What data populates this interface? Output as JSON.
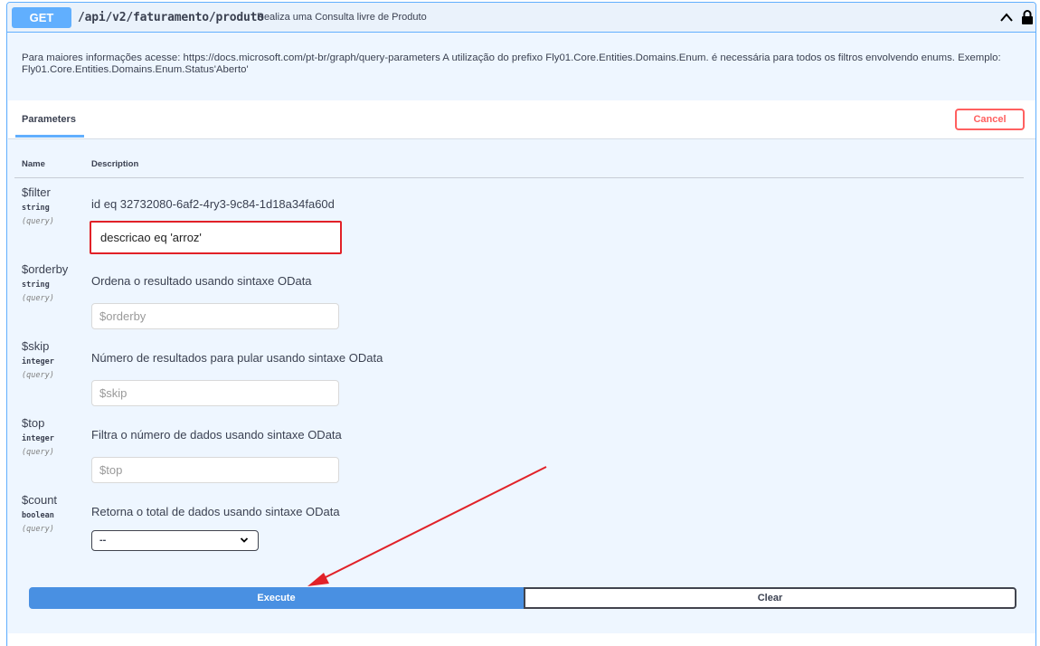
{
  "operation": {
    "method": "GET",
    "path": "/api/v2/faturamento/produto",
    "summary": "Realiza uma Consulta livre de Produto",
    "description_line1": "Para maiores informações acesse: https://docs.microsoft.com/pt-br/graph/query-parameters A utilização do prefixo Fly01.Core.Entities.Domains.Enum. é necessária para todos os filtros envolvendo enums. Exemplo:",
    "description_line2": "Fly01.Core.Entities.Domains.Enum.Status'Aberto'"
  },
  "tabs": {
    "parameters": "Parameters",
    "cancel": "Cancel"
  },
  "columns": {
    "name": "Name",
    "description": "Description"
  },
  "params": [
    {
      "name": "$filter",
      "type": "string",
      "in": "(query)",
      "description": "id eq 32732080-6af2-4ry3-9c84-1d18a34fa60d",
      "value": "descricao eq 'arroz'"
    },
    {
      "name": "$orderby",
      "type": "string",
      "in": "(query)",
      "description": "Ordena o resultado usando sintaxe OData",
      "placeholder": "$orderby"
    },
    {
      "name": "$skip",
      "type": "integer",
      "in": "(query)",
      "description": "Número de resultados para pular usando sintaxe OData",
      "placeholder": "$skip"
    },
    {
      "name": "$top",
      "type": "integer",
      "in": "(query)",
      "description": "Filtra o número de dados usando sintaxe OData",
      "placeholder": "$top"
    },
    {
      "name": "$count",
      "type": "boolean",
      "in": "(query)",
      "description": "Retorna o total de dados usando sintaxe OData",
      "selected": "--"
    }
  ],
  "actions": {
    "execute": "Execute",
    "clear": "Clear"
  },
  "colors": {
    "get_blue": "#61affe",
    "execute_blue": "#4990e2",
    "cancel_red": "#ff6060",
    "annotation_red": "#e12128"
  }
}
